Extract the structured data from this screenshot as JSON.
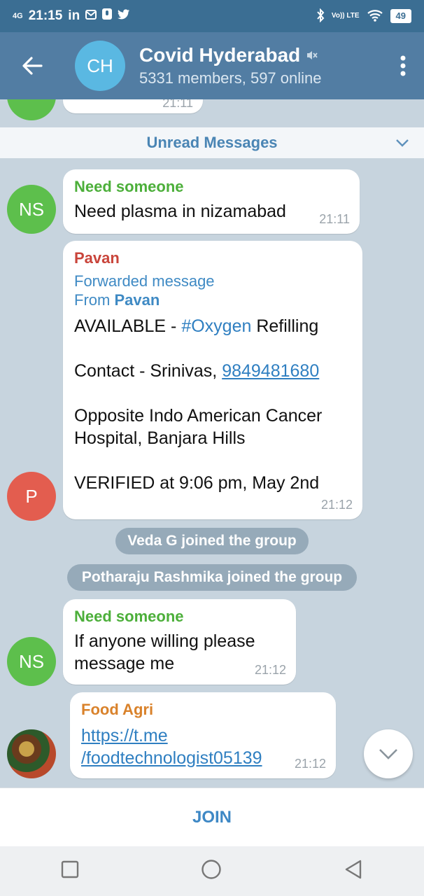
{
  "status_bar": {
    "network": "4G",
    "time": "21:15",
    "notifications": "in",
    "volte": "Vo)) LTE",
    "battery": "49"
  },
  "header": {
    "avatar_initials": "CH",
    "title": "Covid Hyderabad",
    "subtitle": "5331 members, 597 online"
  },
  "chat": {
    "prev_time": "21:11",
    "unread_label": "Unread Messages",
    "messages": [
      {
        "sender": "Need someone",
        "avatar": "NS",
        "text": "Need plasma in nizamabad",
        "time": "21:11"
      },
      {
        "sender": "Pavan",
        "avatar": "P",
        "forwarded_label": "Forwarded message",
        "from_label": "From",
        "from_name": "Pavan",
        "line1_prefix": "AVAILABLE - ",
        "line1_hashtag": "#Oxygen",
        "line1_suffix": " Refilling",
        "contact_prefix": "Contact - Srinivas, ",
        "contact_phone": "9849481680",
        "address_1": "Opposite Indo American Cancer",
        "address_2": "Hospital, Banjara Hills",
        "verified": "VERIFIED at 9:06 pm, May 2nd",
        "time": "21:12"
      },
      {
        "sender": "Need someone",
        "avatar": "NS",
        "text_1": "If anyone willing please",
        "text_2": "message me",
        "time": "21:12"
      },
      {
        "sender": "Food Agri",
        "link_1": "https://t.me",
        "link_2": "/foodtechnologist05139",
        "time": "21:12"
      }
    ],
    "service_1": "Veda G joined the group",
    "service_2": "Potharaju Rashmika joined the group"
  },
  "join_label": "JOIN",
  "colors": {
    "header_bg": "#527da3",
    "sender_green": "#4caf3a",
    "sender_red": "#c9443a",
    "sender_orange": "#d9822b",
    "link_blue": "#2f7fc1",
    "avatar_green": "#5dbf4c",
    "avatar_red": "#e35d4f"
  }
}
